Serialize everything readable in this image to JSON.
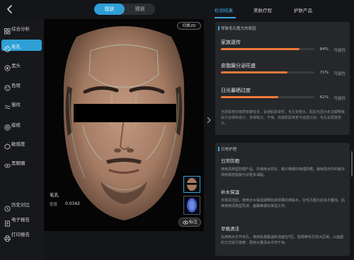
{
  "header": {
    "back_icon": "chevron-left-icon",
    "view_tabs": [
      {
        "label": "现状"
      },
      {
        "label": "预测"
      }
    ],
    "right_tabs": [
      {
        "label": "检测结果"
      },
      {
        "label": "美肤疗程"
      },
      {
        "label": "护肤产品"
      }
    ]
  },
  "sidebar": {
    "items": [
      {
        "label": "综合分析",
        "icon": "grid-icon"
      },
      {
        "label": "毛孔",
        "icon": "pore-icon"
      },
      {
        "label": "黑头",
        "icon": "blackhead-icon",
        "badge": ""
      },
      {
        "label": "色斑",
        "icon": "spot-icon"
      },
      {
        "label": "皱纹",
        "icon": "wrinkle-icon"
      },
      {
        "label": "痤疮",
        "icon": "acne-icon"
      },
      {
        "label": "敏感度",
        "icon": "sensitivity-icon"
      },
      {
        "label": "黑眼圈",
        "icon": "dark-circle-icon",
        "badge": ""
      }
    ],
    "bottom": [
      {
        "label": "历史对比",
        "icon": "history-icon"
      },
      {
        "label": "电子报告",
        "icon": "report-icon"
      },
      {
        "label": "打印报告",
        "icon": "print-icon"
      }
    ]
  },
  "viewer": {
    "switch_label": "切换2D",
    "metric_name": "毛孔",
    "metric_sub": "密度",
    "metric_value": "0.0342",
    "annotate_label": "标注",
    "annotate_icon": "eye-icon"
  },
  "causes": {
    "title": "导致毛孔粗大的原因",
    "items": [
      {
        "name": "家族遗传",
        "percent": "84%",
        "label": "可能性",
        "value": 0.84
      },
      {
        "name": "皮脂腺分泌旺盛",
        "percent": "71%",
        "label": "可能性",
        "value": 0.71
      },
      {
        "name": "日光暴晒过度",
        "percent": "61%",
        "label": "可能性",
        "value": 0.61
      }
    ],
    "note": "当皮肤老旧角质积聚较多，会使肌肤变厚，毛孔变粗大。肌肤也因为无法顺畅吸收分泌保养成分，变得暗沉、干燥。加速肌肤衰老与造成分泌，毛孔会再度变大。"
  },
  "care": {
    "title": "日常护理",
    "tips": [
      {
        "title": "日常防晒",
        "body": "使用清爽型防晒产品，并使用太阳伞、帽子等做好物理防晒，避免阳光中的紫外线刺激皮脂腺分泌更多油脂。"
      },
      {
        "title": "补水保湿",
        "body": "日常清洁后，使用补水保湿或带收敛效果的爽肤水，在毛孔粗大处多次叠加。后续使用清爽型乳液、面霜等做好保湿工作。"
      },
      {
        "title": "早晚清洁",
        "body": "先用热水打开毛孔，使用氨基酸温和洁面在T区、脸颊等毛孔较大区域，以画圆的方式进行按摩，再用大量清水冲洗干净。"
      }
    ]
  }
}
